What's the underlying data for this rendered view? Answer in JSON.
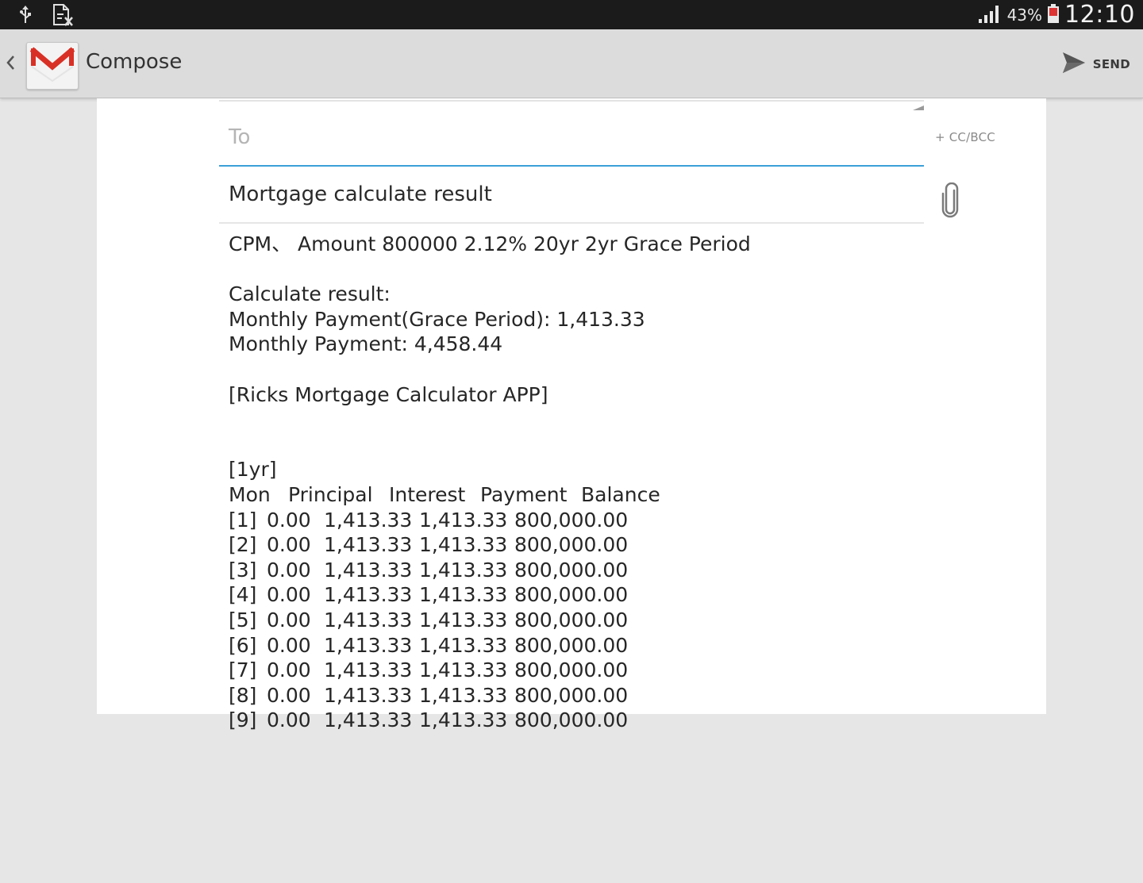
{
  "status_bar": {
    "battery_percent": "43%",
    "clock": "12:10"
  },
  "action_bar": {
    "title": "Compose",
    "send_label": "SEND"
  },
  "compose": {
    "to_placeholder": "To",
    "cc_bcc_label": "+ CC/BCC",
    "subject": "Mortgage calculate result",
    "body": {
      "summary_line": "CPM、 Amount 800000 2.12% 20yr 2yr Grace Period",
      "result_heading": "Calculate result:",
      "grace_payment_line": "Monthly Payment(Grace Period): 1,413.33",
      "monthly_payment_line": "Monthly Payment: 4,458.44",
      "app_signature": "[Ricks Mortgage Calculator APP]",
      "year_label": "[1yr]",
      "table_headers": [
        "Mon",
        "Principal",
        "Interest",
        "Payment",
        "Balance"
      ],
      "table_rows": [
        [
          "[1]",
          "0.00",
          "1,413.33",
          "1,413.33",
          "800,000.00"
        ],
        [
          "[2]",
          "0.00",
          "1,413.33",
          "1,413.33",
          "800,000.00"
        ],
        [
          "[3]",
          "0.00",
          "1,413.33",
          "1,413.33",
          "800,000.00"
        ],
        [
          "[4]",
          "0.00",
          "1,413.33",
          "1,413.33",
          "800,000.00"
        ],
        [
          "[5]",
          "0.00",
          "1,413.33",
          "1,413.33",
          "800,000.00"
        ],
        [
          "[6]",
          "0.00",
          "1,413.33",
          "1,413.33",
          "800,000.00"
        ],
        [
          "[7]",
          "0.00",
          "1,413.33",
          "1,413.33",
          "800,000.00"
        ],
        [
          "[8]",
          "0.00",
          "1,413.33",
          "1,413.33",
          "800,000.00"
        ],
        [
          "[9]",
          "0.00",
          "1,413.33",
          "1,413.33",
          "800,000.00"
        ]
      ]
    }
  },
  "colors": {
    "status_bar": "#1b1b1b",
    "action_bar": "#dcdcdc",
    "accent_underline": "#3ba0d6",
    "gmail_red": "#d93025"
  },
  "icons": [
    "usb-icon",
    "document-icon",
    "signal-icon",
    "battery-icon",
    "back-chevron-icon",
    "gmail-icon",
    "send-icon",
    "paperclip-icon"
  ]
}
